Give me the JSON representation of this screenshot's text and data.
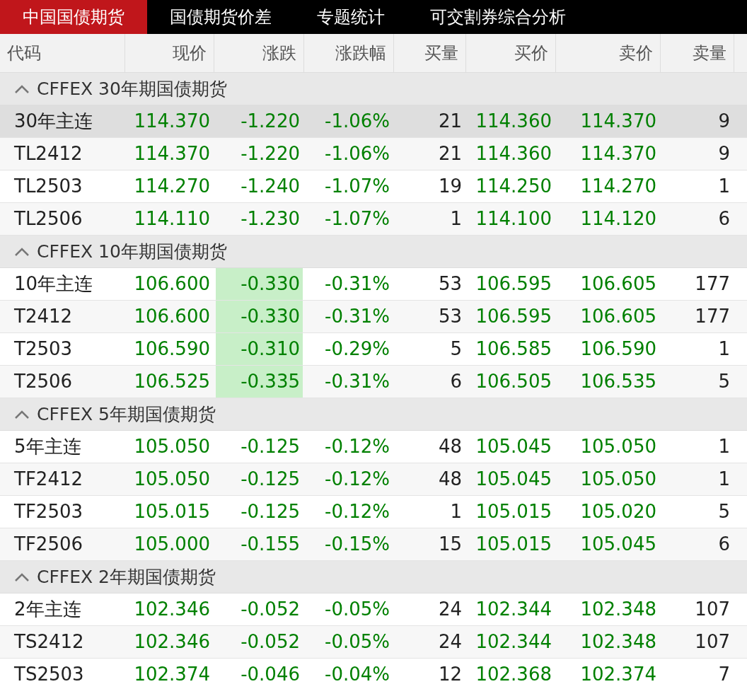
{
  "tabs": [
    {
      "label": "中国国债期货",
      "selected": true
    },
    {
      "label": "国债期货价差",
      "selected": false
    },
    {
      "label": "专题统计",
      "selected": false
    },
    {
      "label": "可交割券综合分析",
      "selected": false
    }
  ],
  "columns": [
    {
      "label": "代码",
      "kind": "code"
    },
    {
      "label": "现价",
      "kind": "price"
    },
    {
      "label": "涨跌",
      "kind": "price"
    },
    {
      "label": "涨跌幅",
      "kind": "price"
    },
    {
      "label": "买量",
      "kind": "volume"
    },
    {
      "label": "买价",
      "kind": "price"
    },
    {
      "label": "卖价",
      "kind": "price"
    },
    {
      "label": "卖量",
      "kind": "volume"
    }
  ],
  "groups": [
    {
      "title": "CFFEX 30年期国债期货",
      "expanded": true,
      "rows": [
        {
          "cells": [
            "30年主连",
            "114.370",
            "-1.220",
            "-1.06%",
            "21",
            "114.360",
            "114.370",
            "9"
          ],
          "selected": true,
          "change_highlighted": false
        },
        {
          "cells": [
            "TL2412",
            "114.370",
            "-1.220",
            "-1.06%",
            "21",
            "114.360",
            "114.370",
            "9"
          ],
          "selected": false,
          "change_highlighted": false
        },
        {
          "cells": [
            "TL2503",
            "114.270",
            "-1.240",
            "-1.07%",
            "19",
            "114.250",
            "114.270",
            "1"
          ],
          "selected": false,
          "change_highlighted": false
        },
        {
          "cells": [
            "TL2506",
            "114.110",
            "-1.230",
            "-1.07%",
            "1",
            "114.100",
            "114.120",
            "6"
          ],
          "selected": false,
          "change_highlighted": false
        }
      ]
    },
    {
      "title": "CFFEX 10年期国债期货",
      "expanded": true,
      "rows": [
        {
          "cells": [
            "10年主连",
            "106.600",
            "-0.330",
            "-0.31%",
            "53",
            "106.595",
            "106.605",
            "177"
          ],
          "selected": false,
          "change_highlighted": true
        },
        {
          "cells": [
            "T2412",
            "106.600",
            "-0.330",
            "-0.31%",
            "53",
            "106.595",
            "106.605",
            "177"
          ],
          "selected": false,
          "change_highlighted": true
        },
        {
          "cells": [
            "T2503",
            "106.590",
            "-0.310",
            "-0.29%",
            "5",
            "106.585",
            "106.590",
            "1"
          ],
          "selected": false,
          "change_highlighted": true
        },
        {
          "cells": [
            "T2506",
            "106.525",
            "-0.335",
            "-0.31%",
            "6",
            "106.505",
            "106.535",
            "5"
          ],
          "selected": false,
          "change_highlighted": true
        }
      ]
    },
    {
      "title": "CFFEX 5年期国债期货",
      "expanded": true,
      "rows": [
        {
          "cells": [
            "5年主连",
            "105.050",
            "-0.125",
            "-0.12%",
            "48",
            "105.045",
            "105.050",
            "1"
          ],
          "selected": false,
          "change_highlighted": false
        },
        {
          "cells": [
            "TF2412",
            "105.050",
            "-0.125",
            "-0.12%",
            "48",
            "105.045",
            "105.050",
            "1"
          ],
          "selected": false,
          "change_highlighted": false
        },
        {
          "cells": [
            "TF2503",
            "105.015",
            "-0.125",
            "-0.12%",
            "1",
            "105.015",
            "105.020",
            "5"
          ],
          "selected": false,
          "change_highlighted": false
        },
        {
          "cells": [
            "TF2506",
            "105.000",
            "-0.155",
            "-0.15%",
            "15",
            "105.015",
            "105.045",
            "6"
          ],
          "selected": false,
          "change_highlighted": false
        }
      ]
    },
    {
      "title": "CFFEX 2年期国债期货",
      "expanded": true,
      "rows": [
        {
          "cells": [
            "2年主连",
            "102.346",
            "-0.052",
            "-0.05%",
            "24",
            "102.344",
            "102.348",
            "107"
          ],
          "selected": false,
          "change_highlighted": false
        },
        {
          "cells": [
            "TS2412",
            "102.346",
            "-0.052",
            "-0.05%",
            "24",
            "102.344",
            "102.348",
            "107"
          ],
          "selected": false,
          "change_highlighted": false
        },
        {
          "cells": [
            "TS2503",
            "102.374",
            "-0.046",
            "-0.04%",
            "12",
            "102.368",
            "102.374",
            "7"
          ],
          "selected": false,
          "change_highlighted": false
        }
      ]
    }
  ]
}
